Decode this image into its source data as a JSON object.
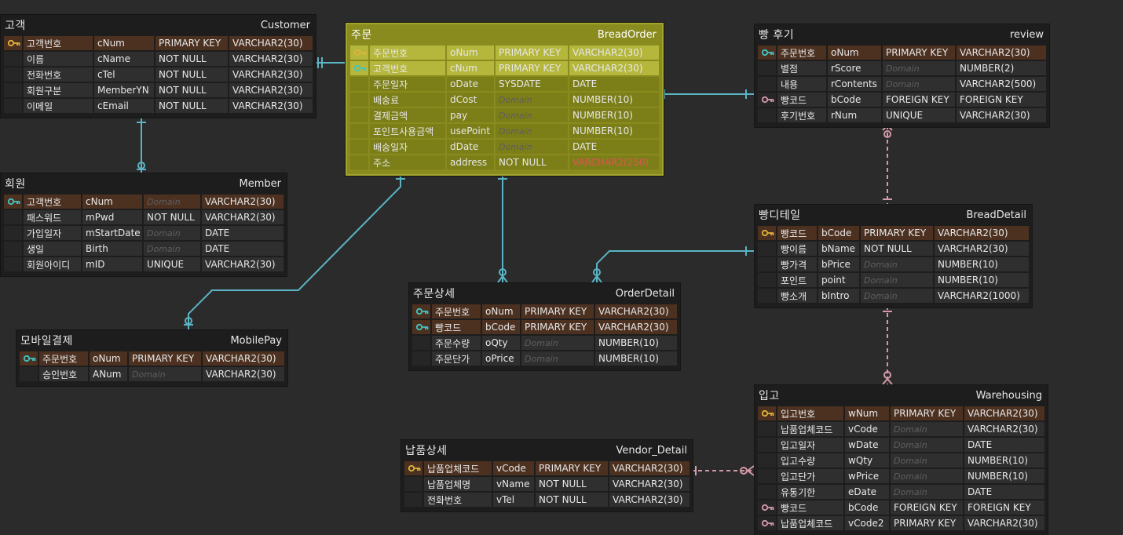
{
  "colors": {
    "background": "#2b2b2b",
    "entity": "#1d1d1d",
    "pk_row": "#4c3121",
    "selected": "#898b1e",
    "line_blue": "#5ab4c4",
    "line_pink": "#d39aa8",
    "key_gold": "#e0b23a",
    "key_teal": "#3fc6c6",
    "key_pink": "#d39aa8"
  },
  "entities": {
    "customer": {
      "logical": "고객",
      "physical": "Customer",
      "rows": [
        {
          "key": "gold",
          "pk": true,
          "lname": "고객번호",
          "pname": "cNum",
          "cons": "PRIMARY KEY",
          "type": "VARCHAR2(30)"
        },
        {
          "key": "",
          "lname": "이름",
          "pname": "cName",
          "cons": "NOT NULL",
          "type": "VARCHAR2(30)"
        },
        {
          "key": "",
          "lname": "전화번호",
          "pname": "cTel",
          "cons": "NOT NULL",
          "type": "VARCHAR2(30)"
        },
        {
          "key": "",
          "lname": "회원구분",
          "pname": "MemberYN",
          "cons": "NOT NULL",
          "type": "VARCHAR2(30)"
        },
        {
          "key": "",
          "lname": "이메일",
          "pname": "cEmail",
          "cons": "NOT NULL",
          "type": "VARCHAR2(30)"
        }
      ]
    },
    "member": {
      "logical": "회원",
      "physical": "Member",
      "rows": [
        {
          "key": "teal",
          "pk": true,
          "lname": "고객번호",
          "pname": "cNum",
          "cons": "Domain",
          "type": "VARCHAR2(30)"
        },
        {
          "key": "",
          "lname": "패스워드",
          "pname": "mPwd",
          "cons": "NOT NULL",
          "type": "VARCHAR2(30)"
        },
        {
          "key": "",
          "lname": "가입일자",
          "pname": "mStartDate",
          "cons": "Domain",
          "type": "DATE"
        },
        {
          "key": "",
          "lname": "생일",
          "pname": "Birth",
          "cons": "Domain",
          "type": "DATE"
        },
        {
          "key": "",
          "lname": "회원아이디",
          "pname": "mID",
          "cons": "UNIQUE",
          "type": "VARCHAR2(30)"
        }
      ]
    },
    "mobilepay": {
      "logical": "모바일결제",
      "physical": "MobilePay",
      "rows": [
        {
          "key": "teal",
          "pk": true,
          "lname": "주문번호",
          "pname": "oNum",
          "cons": "PRIMARY KEY",
          "type": "VARCHAR2(30)"
        },
        {
          "key": "",
          "lname": "승인번호",
          "pname": "ANum",
          "cons": "Domain",
          "type": "VARCHAR2(30)"
        }
      ]
    },
    "breadorder": {
      "logical": "주문",
      "physical": "BreadOrder",
      "rows": [
        {
          "key": "gold",
          "pk": true,
          "lname": "주문번호",
          "pname": "oNum",
          "cons": "PRIMARY KEY",
          "type": "VARCHAR2(30)"
        },
        {
          "key": "teal",
          "pk": true,
          "lname": "고객번호",
          "pname": "cNum",
          "cons": "PRIMARY KEY",
          "type": "VARCHAR2(30)"
        },
        {
          "key": "",
          "lname": "주문일자",
          "pname": "oDate",
          "cons": "SYSDATE",
          "type": "DATE"
        },
        {
          "key": "",
          "lname": "배송료",
          "pname": "dCost",
          "cons": "Domain",
          "type": "NUMBER(10)"
        },
        {
          "key": "",
          "lname": "결제금액",
          "pname": "pay",
          "cons": "Domain",
          "type": "NUMBER(10)"
        },
        {
          "key": "",
          "lname": "포인트사용금액",
          "pname": "usePoint",
          "cons": "Domain",
          "type": "NUMBER(10)"
        },
        {
          "key": "",
          "lname": "배송일자",
          "pname": "dDate",
          "cons": "Domain",
          "type": "DATE"
        },
        {
          "key": "",
          "lname": "주소",
          "pname": "address",
          "cons": "NOT NULL",
          "type": "VARCHAR2(250)",
          "typeRed": true
        }
      ]
    },
    "orderdetail": {
      "logical": "주문상세",
      "physical": "OrderDetail",
      "rows": [
        {
          "key": "teal",
          "pk": true,
          "lname": "주문번호",
          "pname": "oNum",
          "cons": "PRIMARY KEY",
          "type": "VARCHAR2(30)"
        },
        {
          "key": "teal",
          "pk": true,
          "lname": "빵코드",
          "pname": "bCode",
          "cons": "PRIMARY KEY",
          "type": "VARCHAR2(30)"
        },
        {
          "key": "",
          "lname": "주문수량",
          "pname": "oQty",
          "cons": "Domain",
          "type": "NUMBER(10)"
        },
        {
          "key": "",
          "lname": "주문단가",
          "pname": "oPrice",
          "cons": "Domain",
          "type": "NUMBER(10)"
        }
      ]
    },
    "review": {
      "logical": "빵 후기",
      "physical": "review",
      "rows": [
        {
          "key": "teal",
          "pk": true,
          "lname": "주문번호",
          "pname": "oNum",
          "cons": "PRIMARY KEY",
          "type": "VARCHAR2(30)"
        },
        {
          "key": "",
          "lname": "별점",
          "pname": "rScore",
          "cons": "Domain",
          "type": "NUMBER(2)"
        },
        {
          "key": "",
          "lname": "내용",
          "pname": "rContents",
          "cons": "Domain",
          "type": "VARCHAR2(500)"
        },
        {
          "key": "pink",
          "lname": "빵코드",
          "pname": "bCode",
          "cons": "FOREIGN KEY",
          "type": "FOREIGN KEY"
        },
        {
          "key": "",
          "lname": "후기번호",
          "pname": "rNum",
          "cons": "UNIQUE",
          "type": "VARCHAR2(30)"
        }
      ]
    },
    "breaddetail": {
      "logical": "빵디테일",
      "physical": "BreadDetail",
      "rows": [
        {
          "key": "gold",
          "pk": true,
          "lname": "빵코드",
          "pname": "bCode",
          "cons": "PRIMARY KEY",
          "type": "VARCHAR2(30)"
        },
        {
          "key": "",
          "lname": "빵이름",
          "pname": "bName",
          "cons": "NOT NULL",
          "type": "VARCHAR2(30)"
        },
        {
          "key": "",
          "lname": "빵가격",
          "pname": "bPrice",
          "cons": "Domain",
          "type": "NUMBER(10)"
        },
        {
          "key": "",
          "lname": "포인트",
          "pname": "point",
          "cons": "Domain",
          "type": "NUMBER(10)"
        },
        {
          "key": "",
          "lname": "빵소개",
          "pname": "bIntro",
          "cons": "Domain",
          "type": "VARCHAR2(1000)"
        }
      ]
    },
    "warehousing": {
      "logical": "입고",
      "physical": "Warehousing",
      "rows": [
        {
          "key": "gold",
          "pk": true,
          "lname": "입고번호",
          "pname": "wNum",
          "cons": "PRIMARY KEY",
          "type": "VARCHAR2(30)"
        },
        {
          "key": "",
          "lname": "납품업체코드",
          "pname": "vCode",
          "cons": "Domain",
          "type": "VARCHAR2(30)"
        },
        {
          "key": "",
          "lname": "입고일자",
          "pname": "wDate",
          "cons": "Domain",
          "type": "DATE"
        },
        {
          "key": "",
          "lname": "입고수량",
          "pname": "wQty",
          "cons": "Domain",
          "type": "NUMBER(10)"
        },
        {
          "key": "",
          "lname": "입고단가",
          "pname": "wPrice",
          "cons": "Domain",
          "type": "NUMBER(10)"
        },
        {
          "key": "",
          "lname": "유통기한",
          "pname": "eDate",
          "cons": "Domain",
          "type": "DATE"
        },
        {
          "key": "pink",
          "lname": "빵코드",
          "pname": "bCode",
          "cons": "FOREIGN KEY",
          "type": "FOREIGN KEY"
        },
        {
          "key": "pink",
          "lname": "납품업체코드",
          "pname": "vCode2",
          "cons": "PRIMARY KEY",
          "type": "VARCHAR2(30)"
        }
      ]
    },
    "vendordetail": {
      "logical": "납품상세",
      "physical": "Vendor_Detail",
      "rows": [
        {
          "key": "gold",
          "pk": true,
          "lname": "납품업체코드",
          "pname": "vCode",
          "cons": "PRIMARY KEY",
          "type": "VARCHAR2(30)"
        },
        {
          "key": "",
          "lname": "납품업체명",
          "pname": "vName",
          "cons": "NOT NULL",
          "type": "VARCHAR2(30)"
        },
        {
          "key": "",
          "lname": "전화번호",
          "pname": "vTel",
          "cons": "NOT NULL",
          "type": "VARCHAR2(30)"
        }
      ]
    }
  }
}
